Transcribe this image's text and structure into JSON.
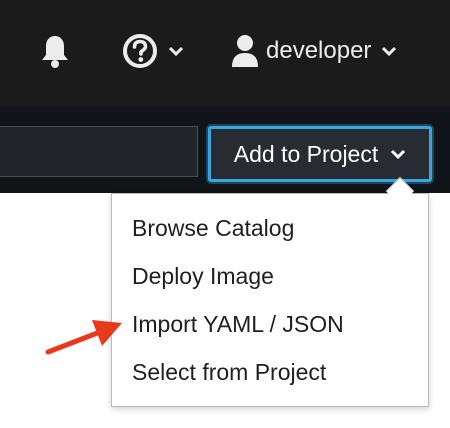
{
  "masthead": {
    "notifications_icon": "bell-icon",
    "help_icon": "question-circle-icon",
    "user": {
      "icon": "user-icon",
      "name": "developer"
    },
    "dropdown_icon": "chevron-down-icon"
  },
  "toolbar": {
    "add_to_project_label": "Add to Project"
  },
  "add_menu": {
    "items": [
      {
        "label": "Browse Catalog"
      },
      {
        "label": "Deploy Image"
      },
      {
        "label": "Import YAML / JSON"
      },
      {
        "label": "Select from Project"
      }
    ]
  },
  "annotation": {
    "icon": "red-arrow-pointer",
    "color": "#e8391d"
  },
  "colors": {
    "masthead_bg": "#1b1b1b",
    "button_focus": "#39a5dc"
  }
}
